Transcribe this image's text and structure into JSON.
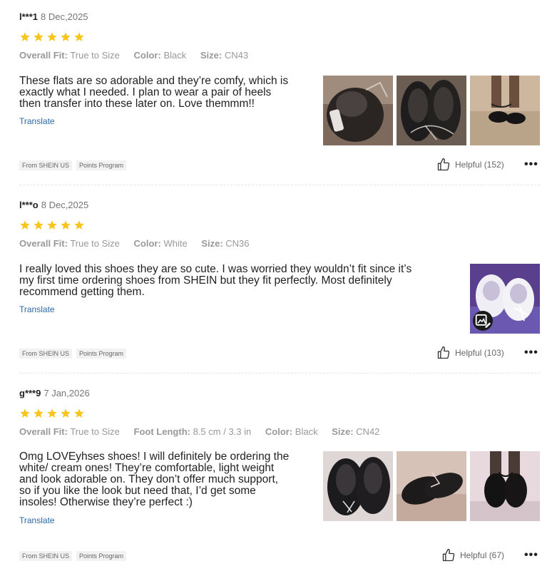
{
  "reviews": [
    {
      "user": "l***1",
      "date": "8 Dec,2025",
      "rating": 5,
      "meta": [
        {
          "key": "Overall Fit:",
          "value": "True to Size"
        },
        {
          "key": "Color:",
          "value": "Black"
        },
        {
          "key": "Size:",
          "value": "CN43"
        }
      ],
      "text_lines": [
        "These flats are so adorable and they’re comfy, which is",
        "exactly what I needed. I plan to wear a pair of heels",
        "then transfer into these later on. Love themmm!!"
      ],
      "translate": "Translate",
      "tags": [
        "From SHEIN US",
        "Points Program"
      ],
      "helpful": "Helpful (152)",
      "more": "•••"
    },
    {
      "user": "l***o",
      "date": "8 Dec,2025",
      "rating": 5,
      "meta": [
        {
          "key": "Overall Fit:",
          "value": "True to Size"
        },
        {
          "key": "Color:",
          "value": "White"
        },
        {
          "key": "Size:",
          "value": "CN36"
        }
      ],
      "text_lines": [
        "I really loved this shoes they are so cute. I was worried they wouldn’t fit since it’s",
        "my first time ordering shoes from SHEIN but they fit perfectly. Most definitely",
        "recommend getting them."
      ],
      "translate": "Translate",
      "tags": [
        "From SHEIN US",
        "Points Program"
      ],
      "helpful": "Helpful (103)",
      "more": "•••"
    },
    {
      "user": "g***9",
      "date": "7 Jan,2026",
      "rating": 5,
      "meta": [
        {
          "key": "Overall Fit:",
          "value": "True to Size"
        },
        {
          "key": "Foot Length:",
          "value": "8.5 cm / 3.3 in"
        },
        {
          "key": "Color:",
          "value": "Black"
        },
        {
          "key": "Size:",
          "value": "CN42"
        }
      ],
      "text_lines": [
        "Omg LOVEyhses shoes! I will definitely be ordering the",
        "white/ cream ones! They’re comfortable, light weight",
        "and look adorable on. They don’t offer much support,",
        "so if you like the look but need that, I’d get some",
        "insoles! Otherwise they’re perfect :)"
      ],
      "translate": "Translate",
      "tags": [
        "From SHEIN US",
        "Points Program"
      ],
      "helpful": "Helpful (67)",
      "more": "•••"
    }
  ],
  "colors": {
    "star": "#f8c51c",
    "link": "#2d68a8",
    "muted": "#999999"
  }
}
